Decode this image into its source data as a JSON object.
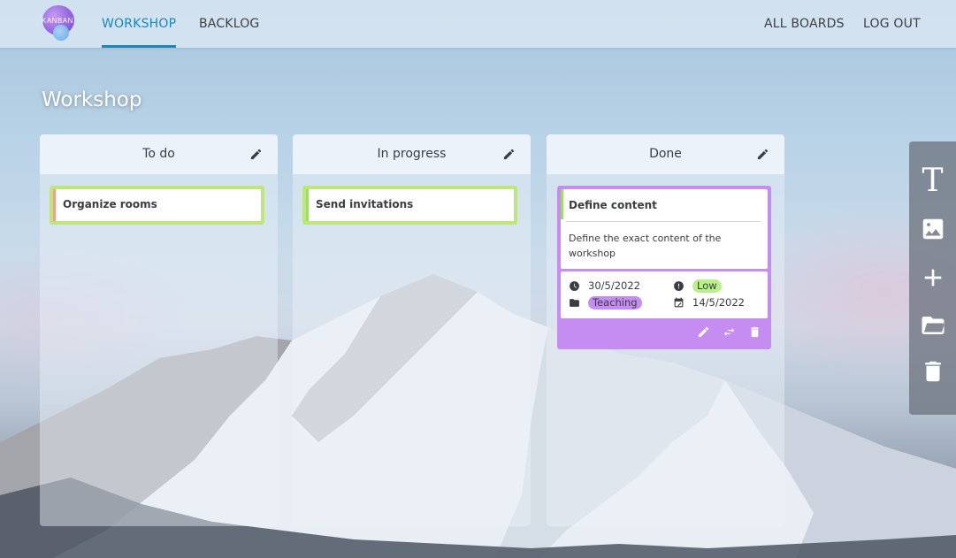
{
  "nav": {
    "logo_text": "KANBAN",
    "tabs": [
      {
        "label": "WORKSHOP",
        "active": true
      },
      {
        "label": "BACKLOG",
        "active": false
      }
    ],
    "right_links": [
      "ALL BOARDS",
      "LOG OUT"
    ]
  },
  "board": {
    "title": "Workshop"
  },
  "columns": [
    {
      "title": "To do",
      "cards": [
        {
          "title": "Organize rooms"
        }
      ]
    },
    {
      "title": "In progress",
      "cards": [
        {
          "title": "Send invitations"
        }
      ]
    },
    {
      "title": "Done",
      "cards": [
        {
          "title": "Define content",
          "description": "Define the exact content of the workshop",
          "due_date": "30/5/2022",
          "priority": "Low",
          "category": "Teaching",
          "created_date": "14/5/2022"
        }
      ]
    }
  ],
  "icons": {
    "column_edit": "pencil-icon",
    "card_actions": [
      "pencil-icon",
      "swap-icon",
      "trash-icon"
    ],
    "meta": [
      "clock-icon",
      "alert-icon",
      "folder-icon",
      "calendar-edit-icon"
    ],
    "toolbar": [
      "text-icon",
      "image-icon",
      "plus-icon",
      "folder-open-icon",
      "trash-icon"
    ]
  },
  "colors": {
    "accent": "#1b86b9",
    "card_green": "#bfe57e",
    "card_purple": "#c58cf1",
    "priority_low": "#b9f08a",
    "bar_red": "#f2a08a",
    "bar_green": "#9fdc6a"
  }
}
